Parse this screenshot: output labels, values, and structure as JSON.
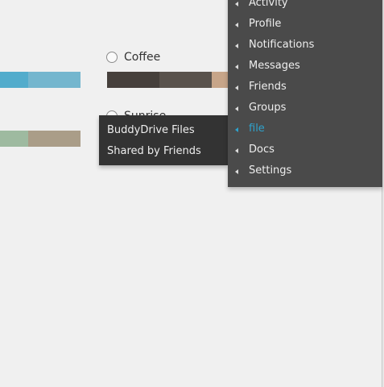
{
  "color_schemes": {
    "coffee": {
      "label": "Coffee",
      "colors": [
        "#46403c",
        "#59524c",
        "#c7a589",
        "#9ea476"
      ]
    },
    "blue": {
      "colors": [
        "#52accc",
        "#74b6ce"
      ]
    },
    "other": {
      "label": "Sunrise",
      "label_partial": "Sunri...",
      "colors": [
        "#9ebaa0",
        "#aa9d88"
      ]
    }
  },
  "submenu": {
    "items": [
      "BuddyDrive Files",
      "Shared by Friends"
    ]
  },
  "main_menu": {
    "items": [
      {
        "label": "Activity",
        "active": false
      },
      {
        "label": "Profile",
        "active": false
      },
      {
        "label": "Notifications",
        "active": false
      },
      {
        "label": "Messages",
        "active": false
      },
      {
        "label": "Friends",
        "active": false
      },
      {
        "label": "Groups",
        "active": false
      },
      {
        "label": "file",
        "active": true
      },
      {
        "label": "Docs",
        "active": false
      },
      {
        "label": "Settings",
        "active": false
      }
    ],
    "arrow_icon": "left-triangle-icon",
    "active_color": "#2ea2cc",
    "background": "#4a4a4a",
    "submenu_background": "#333333"
  }
}
